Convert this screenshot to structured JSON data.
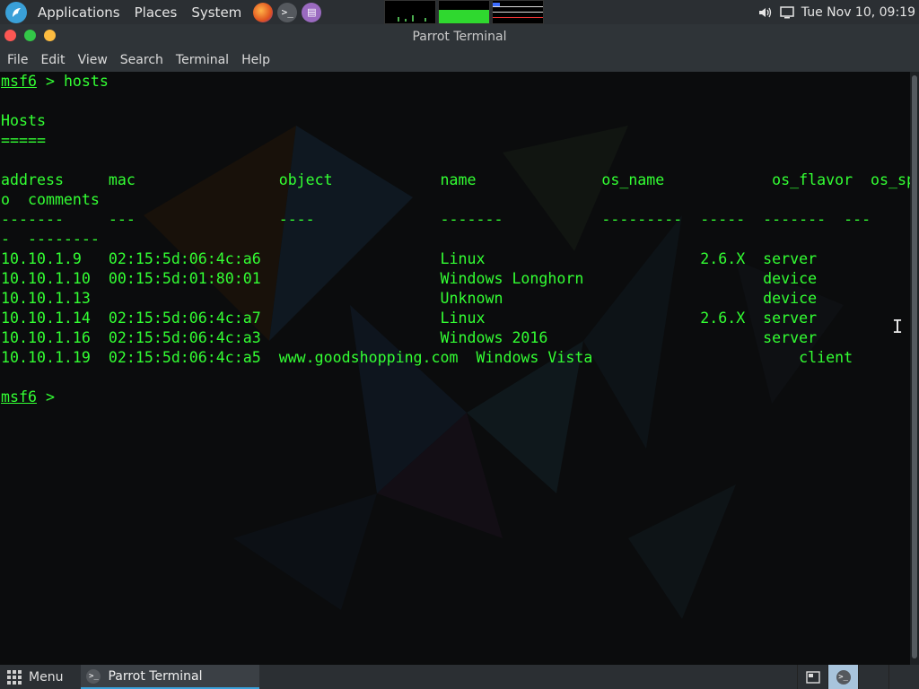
{
  "top_panel": {
    "applications": "Applications",
    "places": "Places",
    "system": "System",
    "launchers": [
      "firefox-icon",
      "terminal-icon",
      "text-editor-icon"
    ],
    "clock": "Tue Nov 10, 09:19"
  },
  "window": {
    "title": "Parrot Terminal"
  },
  "menubar": [
    "File",
    "Edit",
    "View",
    "Search",
    "Terminal",
    "Help"
  ],
  "terminal": {
    "prompt": "msf6",
    "lines": [
      {
        "prompt": "msf6",
        "text": " > hosts"
      },
      {
        "text": ""
      },
      {
        "text": "Hosts"
      },
      {
        "text": "====="
      },
      {
        "text": ""
      },
      {
        "text": "address     mac                object            name              os_name            os_flavor  os_sp  purpose  inf"
      },
      {
        "text": "o  comments"
      },
      {
        "text": "-------     ---                ----              -------           ---------  -----  -------  ---"
      },
      {
        "text": "-  --------"
      },
      {
        "text": "10.10.1.9   02:15:5d:06:4c:a6                    Linux                        2.6.X  server"
      },
      {
        "text": "10.10.1.10  00:15:5d:01:80:01                    Windows Longhorn                    device"
      },
      {
        "text": "10.10.1.13                                       Unknown                             device"
      },
      {
        "text": "10.10.1.14  02:15:5d:06:4c:a7                    Linux                        2.6.X  server"
      },
      {
        "text": "10.10.1.16  02:15:5d:06:4c:a3                    Windows 2016                        server"
      },
      {
        "text": "10.10.1.19  02:15:5d:06:4c:a5  www.goodshopping.com  Windows Vista                       client"
      },
      {
        "text": ""
      },
      {
        "prompt": "msf6",
        "text": " >"
      }
    ]
  },
  "taskbar": {
    "menu_label": "Menu",
    "task_label": "Parrot Terminal"
  },
  "colors": {
    "terminal_text": "#33ff33",
    "panel_bg": "#2b2f33",
    "accent": "#3aa0d8"
  }
}
